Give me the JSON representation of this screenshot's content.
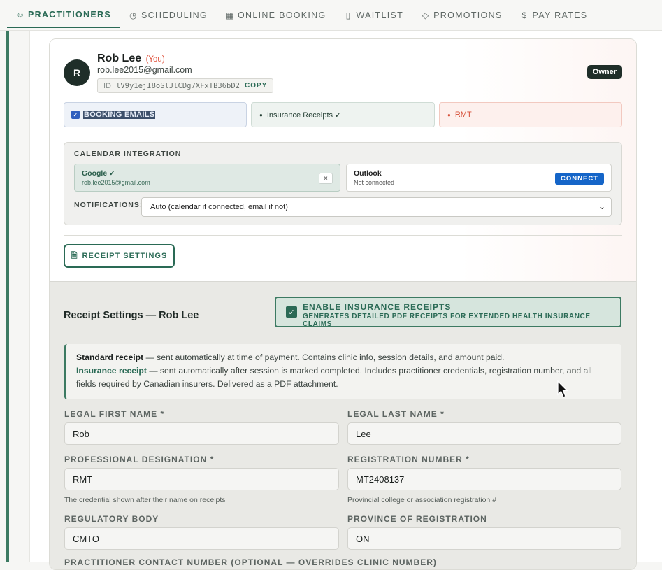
{
  "tabs": [
    {
      "label": "PRACTITIONERS",
      "icon": "user-icon",
      "active": true
    },
    {
      "label": "SCHEDULING",
      "icon": "clock-icon"
    },
    {
      "label": "ONLINE BOOKING",
      "icon": "calendar-icon"
    },
    {
      "label": "WAITLIST",
      "icon": "clipboard-icon"
    },
    {
      "label": "PROMOTIONS",
      "icon": "tag-icon"
    },
    {
      "label": "PAY RATES",
      "icon": "dollar-icon"
    }
  ],
  "practitioner": {
    "initial": "R",
    "name": "Rob Lee",
    "you_tag": "(You)",
    "email": "rob.lee2015@gmail.com",
    "id_label": "ID",
    "id_value": "lV9y1ejI8oSlJlCDg7XFxTB36bD2",
    "copy_label": "COPY",
    "role_badge": "Owner"
  },
  "pills": {
    "booking_emails": "BOOKING EMAILS",
    "insurance_receipts": "Insurance Receipts ✓",
    "rmt": "RMT"
  },
  "calendar": {
    "title": "CALENDAR INTEGRATION",
    "google_name": "Google ✓",
    "google_account": "rob.lee2015@gmail.com",
    "remove_label": "×",
    "outlook_name": "Outlook",
    "outlook_status": "Not connected",
    "connect_label": "CONNECT",
    "notifications_label": "NOTIFICATIONS:",
    "notifications_value": "Auto (calendar if connected, email if not)"
  },
  "receipt_settings_button": "RECEIPT SETTINGS",
  "receipt_panel": {
    "title": "Receipt Settings — Rob Lee",
    "enable_title": "ENABLE INSURANCE RECEIPTS",
    "enable_subtitle": "GENERATES DETAILED PDF RECEIPTS FOR EXTENDED HEALTH INSURANCE CLAIMS",
    "info_standard_label": "Standard receipt",
    "info_standard_text": " — sent automatically at time of payment. Contains clinic info, session details, and amount paid.",
    "info_insurance_label": "Insurance receipt",
    "info_insurance_text": " — sent automatically after session is marked completed. Includes practitioner credentials, registration number, and all fields required by Canadian insurers. Delivered as a PDF attachment."
  },
  "fields": {
    "legal_first_name": {
      "label": "LEGAL FIRST NAME *",
      "value": "Rob"
    },
    "legal_last_name": {
      "label": "LEGAL LAST NAME *",
      "value": "Lee"
    },
    "professional_designation": {
      "label": "PROFESSIONAL DESIGNATION *",
      "value": "RMT",
      "hint": "The credential shown after their name on receipts"
    },
    "registration_number": {
      "label": "REGISTRATION NUMBER *",
      "value": "MT2408137",
      "hint": "Provincial college or association registration #"
    },
    "regulatory_body": {
      "label": "REGULATORY BODY",
      "value": "CMTO"
    },
    "province_of_registration": {
      "label": "PROVINCE OF REGISTRATION",
      "value": "ON"
    },
    "next_label": "PRACTITIONER CONTACT NUMBER (OPTIONAL — OVERRIDES CLINIC NUMBER)"
  }
}
